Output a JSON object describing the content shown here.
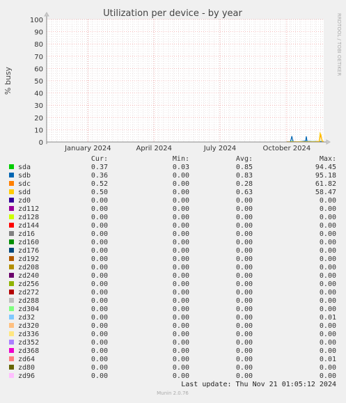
{
  "chart_data": {
    "type": "line",
    "title": "Utilization per device - by year",
    "ylabel": "% busy",
    "xlabel": "",
    "ylim": [
      0,
      100
    ],
    "y_ticks": [
      0,
      10,
      20,
      30,
      40,
      50,
      60,
      70,
      80,
      90,
      100
    ],
    "x_tick_labels": [
      "January 2024",
      "April 2024",
      "July 2024",
      "October 2024"
    ],
    "x_tick_dates": [
      "2024-01-01",
      "2024-04-01",
      "2024-07-01",
      "2024-10-01"
    ],
    "x_range": [
      "2023-11-05",
      "2024-11-21"
    ],
    "grid": true,
    "side_label": "RRDTOOL / TOBI OETIKER",
    "legend_columns": [
      "Cur:",
      "Min:",
      "Avg:",
      "Max:"
    ],
    "series": [
      {
        "name": "sda",
        "color": "#00cc00",
        "cur": "0.37",
        "min": "0.03",
        "avg": "0.85",
        "max": "94.45",
        "points": [
          [
            "2024-10-01",
            0.1
          ],
          [
            "2024-10-05",
            0.2
          ],
          [
            "2024-10-08",
            0.5
          ],
          [
            "2024-10-09",
            0.3
          ],
          [
            "2024-10-15",
            0.2
          ],
          [
            "2024-10-22",
            0.3
          ],
          [
            "2024-10-29",
            0.4
          ],
          [
            "2024-11-05",
            0.3
          ],
          [
            "2024-11-12",
            0.4
          ],
          [
            "2024-11-21",
            0.37
          ]
        ]
      },
      {
        "name": "sdb",
        "color": "#0066b3",
        "cur": "0.36",
        "min": "0.00",
        "avg": "0.83",
        "max": "95.18",
        "points": [
          [
            "2024-10-01",
            0.1
          ],
          [
            "2024-10-06",
            0.3
          ],
          [
            "2024-10-07",
            2.0
          ],
          [
            "2024-10-08",
            4.8
          ],
          [
            "2024-10-09",
            2.0
          ],
          [
            "2024-10-10",
            0.3
          ],
          [
            "2024-10-20",
            0.2
          ],
          [
            "2024-10-27",
            0.8
          ],
          [
            "2024-10-28",
            4.6
          ],
          [
            "2024-10-29",
            0.5
          ],
          [
            "2024-11-05",
            0.3
          ],
          [
            "2024-11-21",
            0.36
          ]
        ]
      },
      {
        "name": "sdc",
        "color": "#ff8000",
        "cur": "0.52",
        "min": "0.00",
        "avg": "0.28",
        "max": "61.82",
        "points": [
          [
            "2024-10-01",
            0.1
          ],
          [
            "2024-10-20",
            0.2
          ],
          [
            "2024-11-10",
            0.3
          ],
          [
            "2024-11-15",
            0.5
          ],
          [
            "2024-11-17",
            6.5
          ],
          [
            "2024-11-18",
            3.0
          ],
          [
            "2024-11-19",
            0.6
          ],
          [
            "2024-11-21",
            0.52
          ]
        ]
      },
      {
        "name": "sdd",
        "color": "#ffcc00",
        "cur": "0.50",
        "min": "0.00",
        "avg": "0.63",
        "max": "58.47",
        "points": [
          [
            "2024-10-01",
            0.1
          ],
          [
            "2024-10-25",
            0.2
          ],
          [
            "2024-11-10",
            0.3
          ],
          [
            "2024-11-15",
            0.5
          ],
          [
            "2024-11-16",
            7.2
          ],
          [
            "2024-11-17",
            6.0
          ],
          [
            "2024-11-18",
            2.5
          ],
          [
            "2024-11-19",
            0.5
          ],
          [
            "2024-11-21",
            0.5
          ]
        ]
      },
      {
        "name": "zd0",
        "color": "#330099",
        "cur": "0.00",
        "min": "0.00",
        "avg": "0.00",
        "max": "0.00",
        "points": []
      },
      {
        "name": "zd112",
        "color": "#990099",
        "cur": "0.00",
        "min": "0.00",
        "avg": "0.00",
        "max": "0.00",
        "points": []
      },
      {
        "name": "zd128",
        "color": "#ccff00",
        "cur": "0.00",
        "min": "0.00",
        "avg": "0.00",
        "max": "0.00",
        "points": []
      },
      {
        "name": "zd144",
        "color": "#ff0000",
        "cur": "0.00",
        "min": "0.00",
        "avg": "0.00",
        "max": "0.00",
        "points": []
      },
      {
        "name": "zd16",
        "color": "#808080",
        "cur": "0.00",
        "min": "0.00",
        "avg": "0.00",
        "max": "0.00",
        "points": []
      },
      {
        "name": "zd160",
        "color": "#008f00",
        "cur": "0.00",
        "min": "0.00",
        "avg": "0.00",
        "max": "0.00",
        "points": []
      },
      {
        "name": "zd176",
        "color": "#00487d",
        "cur": "0.00",
        "min": "0.00",
        "avg": "0.00",
        "max": "0.00",
        "points": []
      },
      {
        "name": "zd192",
        "color": "#b35a00",
        "cur": "0.00",
        "min": "0.00",
        "avg": "0.00",
        "max": "0.00",
        "points": []
      },
      {
        "name": "zd208",
        "color": "#b38f00",
        "cur": "0.00",
        "min": "0.00",
        "avg": "0.00",
        "max": "0.00",
        "points": []
      },
      {
        "name": "zd240",
        "color": "#6b006b",
        "cur": "0.00",
        "min": "0.00",
        "avg": "0.00",
        "max": "0.00",
        "points": []
      },
      {
        "name": "zd256",
        "color": "#8fb300",
        "cur": "0.00",
        "min": "0.00",
        "avg": "0.00",
        "max": "0.00",
        "points": []
      },
      {
        "name": "zd272",
        "color": "#b30000",
        "cur": "0.00",
        "min": "0.00",
        "avg": "0.00",
        "max": "0.00",
        "points": []
      },
      {
        "name": "zd288",
        "color": "#bebebe",
        "cur": "0.00",
        "min": "0.00",
        "avg": "0.00",
        "max": "0.00",
        "points": []
      },
      {
        "name": "zd304",
        "color": "#80ff80",
        "cur": "0.00",
        "min": "0.00",
        "avg": "0.00",
        "max": "0.00",
        "points": []
      },
      {
        "name": "zd32",
        "color": "#80c9ff",
        "cur": "0.00",
        "min": "0.00",
        "avg": "0.00",
        "max": "0.01",
        "points": []
      },
      {
        "name": "zd320",
        "color": "#ffc080",
        "cur": "0.00",
        "min": "0.00",
        "avg": "0.00",
        "max": "0.00",
        "points": []
      },
      {
        "name": "zd336",
        "color": "#ffe680",
        "cur": "0.00",
        "min": "0.00",
        "avg": "0.00",
        "max": "0.00",
        "points": []
      },
      {
        "name": "zd352",
        "color": "#aa80ff",
        "cur": "0.00",
        "min": "0.00",
        "avg": "0.00",
        "max": "0.00",
        "points": []
      },
      {
        "name": "zd368",
        "color": "#ee00cc",
        "cur": "0.00",
        "min": "0.00",
        "avg": "0.00",
        "max": "0.00",
        "points": []
      },
      {
        "name": "zd64",
        "color": "#ff8080",
        "cur": "0.00",
        "min": "0.00",
        "avg": "0.00",
        "max": "0.01",
        "points": []
      },
      {
        "name": "zd80",
        "color": "#666600",
        "cur": "0.00",
        "min": "0.00",
        "avg": "0.00",
        "max": "0.00",
        "points": []
      },
      {
        "name": "zd96",
        "color": "#ffbfff",
        "cur": "0.00",
        "min": "0.00",
        "avg": "0.00",
        "max": "0.00",
        "points": []
      }
    ]
  },
  "footer": {
    "last_update": "Last update:  Thu Nov 21 01:05:12 2024",
    "version": "Munin 2.0.76"
  }
}
